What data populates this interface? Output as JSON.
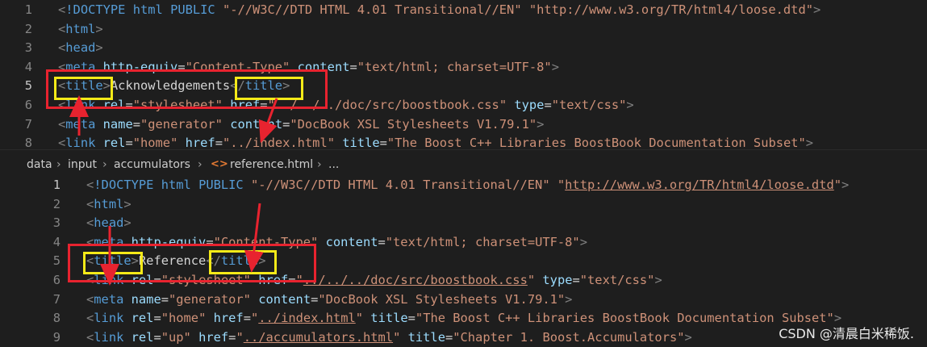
{
  "top_editor": {
    "lines": [
      {
        "num": "1",
        "segments": [
          [
            "p",
            "<"
          ],
          [
            "t",
            "!DOCTYPE"
          ],
          [
            "x",
            " "
          ],
          [
            "t",
            "html"
          ],
          [
            "x",
            " "
          ],
          [
            "t",
            "PUBLIC"
          ],
          [
            "x",
            " "
          ],
          [
            "s",
            "\"-//W3C//DTD HTML 4.01 Transitional//EN\""
          ],
          [
            "x",
            " "
          ],
          [
            "s",
            "\"http://www.w3.org/TR/html4/loose.dtd\""
          ],
          [
            "p",
            ">"
          ]
        ]
      },
      {
        "num": "2",
        "segments": [
          [
            "p",
            "<"
          ],
          [
            "t",
            "html"
          ],
          [
            "p",
            ">"
          ]
        ]
      },
      {
        "num": "3",
        "segments": [
          [
            "p",
            "<"
          ],
          [
            "t",
            "head"
          ],
          [
            "p",
            ">"
          ]
        ]
      },
      {
        "num": "4",
        "segments": [
          [
            "p",
            "<"
          ],
          [
            "t",
            "meta"
          ],
          [
            "x",
            " "
          ],
          [
            "a",
            "http-equiv"
          ],
          [
            "x",
            "="
          ],
          [
            "s",
            "\"Content-Type\""
          ],
          [
            "x",
            " "
          ],
          [
            "a",
            "content"
          ],
          [
            "x",
            "="
          ],
          [
            "s",
            "\"text/html; charset=UTF-8\""
          ],
          [
            "p",
            ">"
          ]
        ]
      },
      {
        "num": "5",
        "segments": [
          [
            "p",
            "<"
          ],
          [
            "t",
            "title"
          ],
          [
            "p",
            ">"
          ],
          [
            "x",
            "Acknowledgements"
          ],
          [
            "p",
            "</"
          ],
          [
            "t",
            "title"
          ],
          [
            "p",
            ">"
          ]
        ]
      },
      {
        "num": "6",
        "segments": [
          [
            "p",
            "<"
          ],
          [
            "t",
            "link"
          ],
          [
            "x",
            " "
          ],
          [
            "a",
            "rel"
          ],
          [
            "x",
            "="
          ],
          [
            "s",
            "\"stylesheet\""
          ],
          [
            "x",
            " "
          ],
          [
            "a",
            "href"
          ],
          [
            "x",
            "="
          ],
          [
            "s",
            "\"../../../doc/src/boostbook.css\""
          ],
          [
            "x",
            " "
          ],
          [
            "a",
            "type"
          ],
          [
            "x",
            "="
          ],
          [
            "s",
            "\"text/css\""
          ],
          [
            "p",
            ">"
          ]
        ]
      },
      {
        "num": "7",
        "segments": [
          [
            "p",
            "<"
          ],
          [
            "t",
            "meta"
          ],
          [
            "x",
            " "
          ],
          [
            "a",
            "name"
          ],
          [
            "x",
            "="
          ],
          [
            "s",
            "\"generator\""
          ],
          [
            "x",
            " "
          ],
          [
            "a",
            "content"
          ],
          [
            "x",
            "="
          ],
          [
            "s",
            "\"DocBook XSL Stylesheets V1.79.1\""
          ],
          [
            "p",
            ">"
          ]
        ]
      },
      {
        "num": "8",
        "segments": [
          [
            "p",
            "<"
          ],
          [
            "t",
            "link"
          ],
          [
            "x",
            " "
          ],
          [
            "a",
            "rel"
          ],
          [
            "x",
            "="
          ],
          [
            "s",
            "\"home\""
          ],
          [
            "x",
            " "
          ],
          [
            "a",
            "href"
          ],
          [
            "x",
            "="
          ],
          [
            "s",
            "\"../index.html\""
          ],
          [
            "x",
            " "
          ],
          [
            "a",
            "title"
          ],
          [
            "x",
            "="
          ],
          [
            "s",
            "\"The Boost C++ Libraries BoostBook Documentation Subset\""
          ],
          [
            "p",
            ">"
          ]
        ]
      }
    ]
  },
  "breadcrumb": {
    "items": [
      "data",
      "input",
      "accumulators",
      "reference.html",
      "..."
    ],
    "file_icon": "<>"
  },
  "bottom_editor": {
    "lines": [
      {
        "num": "1",
        "segments": [
          [
            "p",
            "<"
          ],
          [
            "t",
            "!DOCTYPE"
          ],
          [
            "x",
            " "
          ],
          [
            "t",
            "html"
          ],
          [
            "x",
            " "
          ],
          [
            "t",
            "PUBLIC"
          ],
          [
            "x",
            " "
          ],
          [
            "s",
            "\"-//W3C//DTD HTML 4.01 Transitional//EN\""
          ],
          [
            "x",
            " "
          ],
          [
            "s",
            "\""
          ],
          [
            "su",
            "http://www.w3.org/TR/html4/loose.dtd"
          ],
          [
            "s",
            "\""
          ],
          [
            "p",
            ">"
          ]
        ]
      },
      {
        "num": "2",
        "segments": [
          [
            "p",
            "<"
          ],
          [
            "t",
            "html"
          ],
          [
            "p",
            ">"
          ]
        ]
      },
      {
        "num": "3",
        "segments": [
          [
            "p",
            "<"
          ],
          [
            "t",
            "head"
          ],
          [
            "p",
            ">"
          ]
        ]
      },
      {
        "num": "4",
        "segments": [
          [
            "p",
            "<"
          ],
          [
            "t",
            "meta"
          ],
          [
            "x",
            " "
          ],
          [
            "a",
            "http-equiv"
          ],
          [
            "x",
            "="
          ],
          [
            "s",
            "\"Content-Type\""
          ],
          [
            "x",
            " "
          ],
          [
            "a",
            "content"
          ],
          [
            "x",
            "="
          ],
          [
            "s",
            "\"text/html; charset=UTF-8\""
          ],
          [
            "p",
            ">"
          ]
        ]
      },
      {
        "num": "5",
        "segments": [
          [
            "p",
            "<"
          ],
          [
            "t",
            "title"
          ],
          [
            "p",
            ">"
          ],
          [
            "x",
            "Reference"
          ],
          [
            "p",
            "</"
          ],
          [
            "t",
            "title"
          ],
          [
            "p",
            ">"
          ]
        ]
      },
      {
        "num": "6",
        "segments": [
          [
            "p",
            "<"
          ],
          [
            "t",
            "link"
          ],
          [
            "x",
            " "
          ],
          [
            "a",
            "rel"
          ],
          [
            "x",
            "="
          ],
          [
            "s",
            "\"stylesheet\""
          ],
          [
            "x",
            " "
          ],
          [
            "a",
            "href"
          ],
          [
            "x",
            "="
          ],
          [
            "s",
            "\""
          ],
          [
            "su",
            "../../../doc/src/boostbook.css"
          ],
          [
            "s",
            "\""
          ],
          [
            "x",
            " "
          ],
          [
            "a",
            "type"
          ],
          [
            "x",
            "="
          ],
          [
            "s",
            "\"text/css\""
          ],
          [
            "p",
            ">"
          ]
        ]
      },
      {
        "num": "7",
        "segments": [
          [
            "p",
            "<"
          ],
          [
            "t",
            "meta"
          ],
          [
            "x",
            " "
          ],
          [
            "a",
            "name"
          ],
          [
            "x",
            "="
          ],
          [
            "s",
            "\"generator\""
          ],
          [
            "x",
            " "
          ],
          [
            "a",
            "content"
          ],
          [
            "x",
            "="
          ],
          [
            "s",
            "\"DocBook XSL Stylesheets V1.79.1\""
          ],
          [
            "p",
            ">"
          ]
        ]
      },
      {
        "num": "8",
        "segments": [
          [
            "p",
            "<"
          ],
          [
            "t",
            "link"
          ],
          [
            "x",
            " "
          ],
          [
            "a",
            "rel"
          ],
          [
            "x",
            "="
          ],
          [
            "s",
            "\"home\""
          ],
          [
            "x",
            " "
          ],
          [
            "a",
            "href"
          ],
          [
            "x",
            "="
          ],
          [
            "s",
            "\""
          ],
          [
            "su",
            "../index.html"
          ],
          [
            "s",
            "\""
          ],
          [
            "x",
            " "
          ],
          [
            "a",
            "title"
          ],
          [
            "x",
            "="
          ],
          [
            "s",
            "\"The Boost C++ Libraries BoostBook Documentation Subset\""
          ],
          [
            "p",
            ">"
          ]
        ]
      },
      {
        "num": "9",
        "segments": [
          [
            "p",
            "<"
          ],
          [
            "t",
            "link"
          ],
          [
            "x",
            " "
          ],
          [
            "a",
            "rel"
          ],
          [
            "x",
            "="
          ],
          [
            "s",
            "\"up\""
          ],
          [
            "x",
            " "
          ],
          [
            "a",
            "href"
          ],
          [
            "x",
            "="
          ],
          [
            "s",
            "\""
          ],
          [
            "su",
            "../accumulators.html"
          ],
          [
            "s",
            "\""
          ],
          [
            "x",
            " "
          ],
          [
            "a",
            "title"
          ],
          [
            "x",
            "="
          ],
          [
            "s",
            "\"Chapter 1. Boost.Accumulators\""
          ],
          [
            "p",
            ">"
          ]
        ]
      }
    ]
  },
  "watermark": "CSDN @清晨白米稀饭.",
  "colors": {
    "annotation_box": "#e8232f",
    "highlight_box": "#f5ea18"
  }
}
